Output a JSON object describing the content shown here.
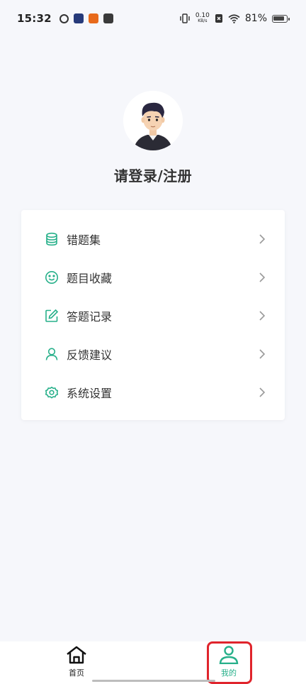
{
  "status_bar": {
    "time": "15:32",
    "net_speed_value": "0.10",
    "net_speed_unit": "KB/s",
    "battery_percent": "81%",
    "battery_level": 0.81
  },
  "profile": {
    "login_text": "请登录/注册"
  },
  "menu": {
    "items": [
      {
        "label": "错题集",
        "icon": "database-icon"
      },
      {
        "label": "题目收藏",
        "icon": "smile-icon"
      },
      {
        "label": "答题记录",
        "icon": "edit-icon"
      },
      {
        "label": "反馈建议",
        "icon": "user-icon"
      },
      {
        "label": "系统设置",
        "icon": "settings-icon"
      }
    ]
  },
  "bottom_nav": {
    "home_label": "首页",
    "mine_label": "我的",
    "active_color": "#27b08a",
    "highlight_color": "#e0242c"
  },
  "theme": {
    "accent": "#27b08a",
    "background": "#f6f7fb"
  }
}
